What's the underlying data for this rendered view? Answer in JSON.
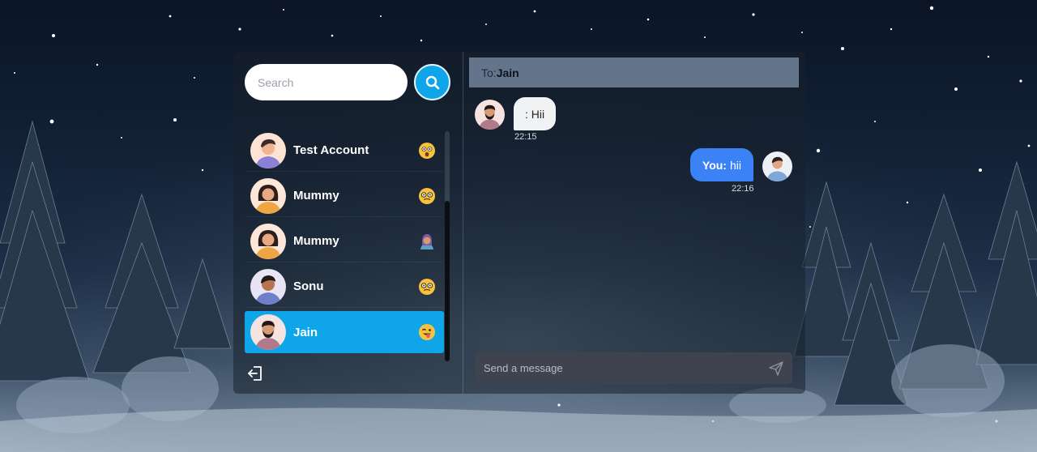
{
  "search": {
    "placeholder": "Search"
  },
  "contacts": [
    {
      "name": "Test Account",
      "status_emoji": "astonished-face-icon"
    },
    {
      "name": "Mummy",
      "status_emoji": "dizzy-face-icon"
    },
    {
      "name": "Mummy",
      "status_emoji": "person-with-headscarf-icon"
    },
    {
      "name": "Sonu",
      "status_emoji": "dizzy-face-icon"
    },
    {
      "name": "Jain",
      "status_emoji": "winking-tongue-face-icon",
      "active": true
    }
  ],
  "chat": {
    "to_prefix": "To:",
    "recipient": "Jain",
    "messages": [
      {
        "direction": "incoming",
        "sender": "",
        "text": ": Hii",
        "time": "22:15"
      },
      {
        "direction": "outgoing",
        "sender": "You:",
        "text": "hii",
        "time": "22:16"
      }
    ],
    "composer_placeholder": "Send a message"
  },
  "colors": {
    "accent": "#0ea5e9",
    "outgoing_bubble": "#3b82f6",
    "header": "#64748b",
    "composer": "#3f4350"
  }
}
